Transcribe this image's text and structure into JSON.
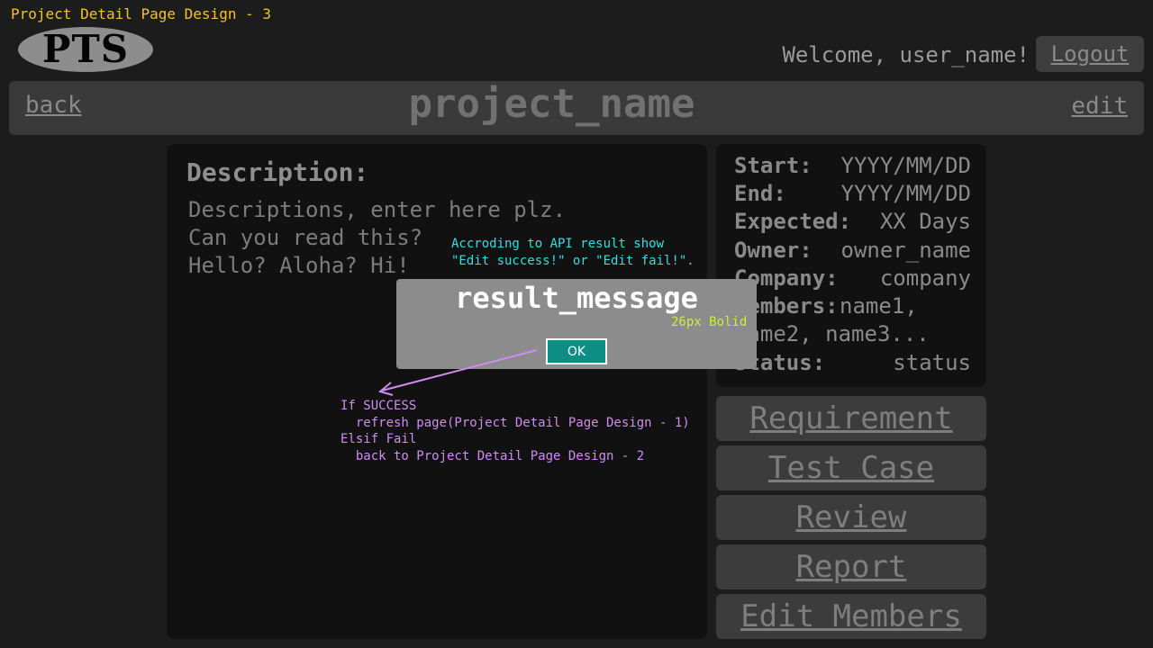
{
  "design_title": "Project Detail Page Design - 3",
  "header": {
    "logo_text": "PTS",
    "welcome_text": "Welcome, user_name!",
    "logout_label": "Logout"
  },
  "title_bar": {
    "back_label": "back",
    "project_name": "project_name",
    "edit_label": "edit"
  },
  "description": {
    "heading": "Description:",
    "text": "Descriptions, enter here plz.\nCan you read this?\nHello? Aloha? Hi!"
  },
  "info": {
    "start_label": "Start:",
    "start_value": "YYYY/MM/DD",
    "end_label": "End:",
    "end_value": "YYYY/MM/DD",
    "expected_label": "Expected:",
    "expected_value": "XX Days",
    "owner_label": "Owner:",
    "owner_value": "owner_name",
    "company_label": "Company:",
    "company_value": "company",
    "members_label": "Members:",
    "members_value_1": "name1,",
    "members_value_2": "name2, name3...",
    "status_label": "Status:",
    "status_value": "status"
  },
  "nav_buttons": {
    "requirement": "Requirement",
    "test_case": "Test Case",
    "review": "Review",
    "report": "Report",
    "edit_members": "Edit Members"
  },
  "dialog": {
    "message": "result_message",
    "ok_label": "OK"
  },
  "annotations": {
    "api_note": "Accroding to API result show\n\"Edit success!\" or \"Edit fail!\".",
    "font_note": "26px Bolid",
    "flow_note": "If SUCCESS\n  refresh page(Project Detail Page Design - 1)\nElsif Fail\n  back to Project Detail Page Design - 2"
  },
  "colors": {
    "background": "#1c1c1c",
    "panel": "#111111",
    "dialog": "#8c8c8c",
    "ok_button": "#0d8d84",
    "design_title": "#f2c233",
    "api_note": "#2fe0e0",
    "font_note": "#c8f03a",
    "flow_note": "#d08cf0"
  }
}
